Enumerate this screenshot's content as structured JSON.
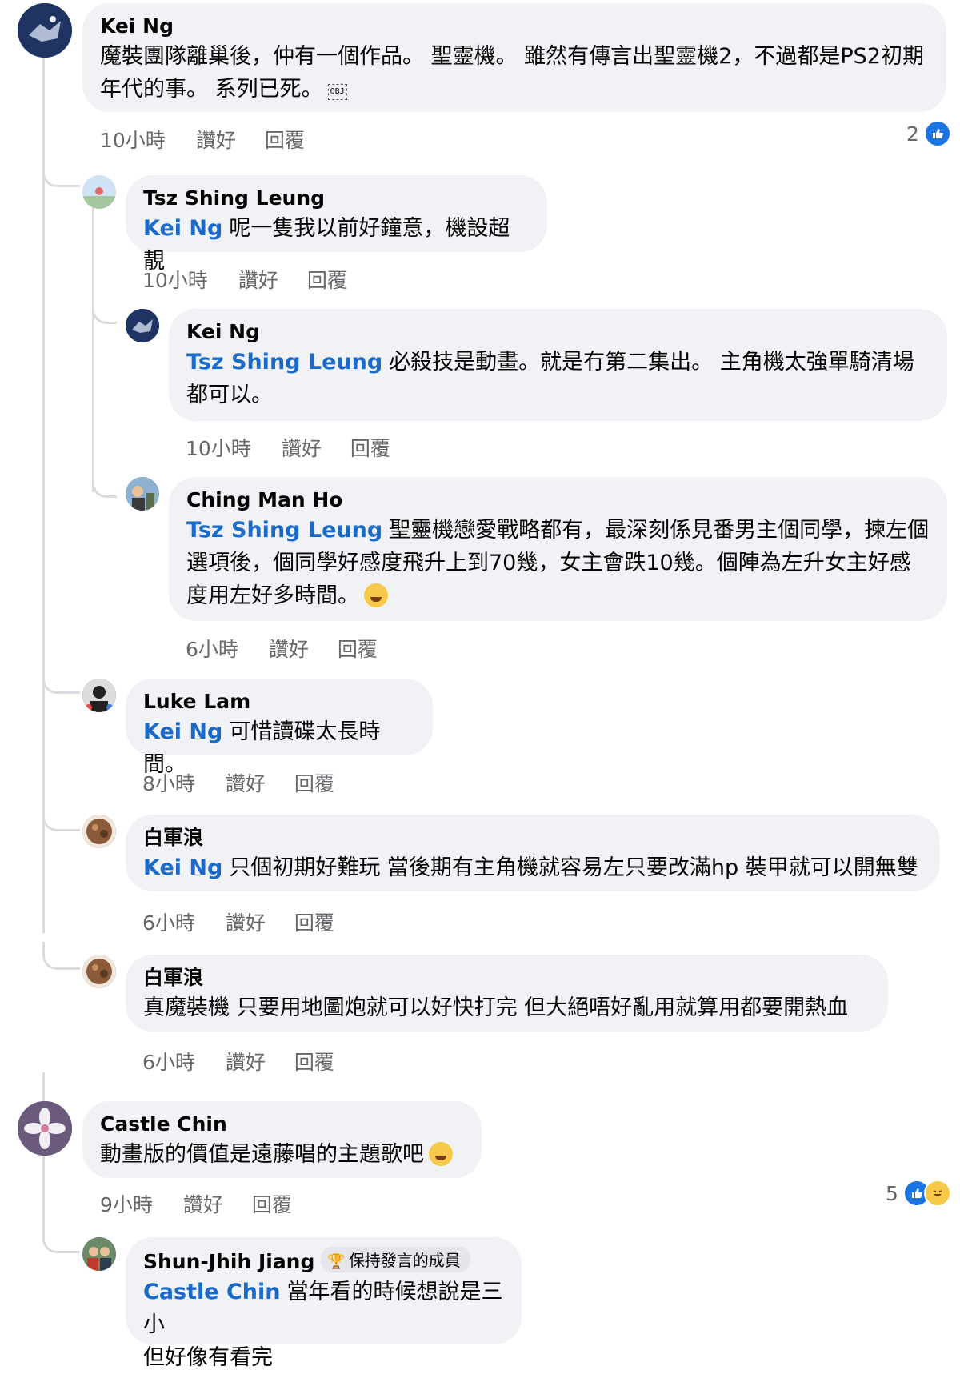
{
  "comments": [
    {
      "author": "Kei Ng",
      "mention": "",
      "text": "魔裝團隊離巢後，仲有一個作品。 聖靈機。 雖然有傳言出聖靈機2，不過都是PS2初期年代的事。 系列已死。",
      "obj": "OBJ",
      "time": "10小時",
      "like": "讚好",
      "reply": "回覆",
      "reactions": "2"
    },
    {
      "author": "Tsz Shing Leung",
      "mention": "Kei Ng",
      "text": "呢一隻我以前好鐘意，機設超靚",
      "time": "10小時",
      "like": "讚好",
      "reply": "回覆"
    },
    {
      "author": "Kei Ng",
      "mention": "Tsz Shing Leung",
      "text": "必殺技是動畫。就是冇第二集出。 主角機太強單騎清場都可以。",
      "time": "10小時",
      "like": "讚好",
      "reply": "回覆"
    },
    {
      "author": "Ching Man Ho",
      "mention": "Tsz Shing Leung",
      "text": "聖靈機戀愛戰略都有，最深刻係見番男主個同學，揀左個選項後，個同學好感度飛升上到70幾，女主會跌10幾。個陣為左升女主好感度用左好多時間。",
      "time": "6小時",
      "like": "讚好",
      "reply": "回覆"
    },
    {
      "author": "Luke Lam",
      "mention": "Kei Ng",
      "text": "可惜讀碟太長時間。",
      "time": "8小時",
      "like": "讚好",
      "reply": "回覆"
    },
    {
      "author": "白軍浪",
      "mention": "Kei Ng",
      "text": "只個初期好難玩 當後期有主角機就容易左只要改滿hp 裝甲就可以開無雙",
      "time": "6小時",
      "like": "讚好",
      "reply": "回覆"
    },
    {
      "author": "白軍浪",
      "mention": "",
      "text": "真魔裝機 只要用地圖炮就可以好快打完 但大絕唔好亂用就算用都要開熱血",
      "time": "6小時",
      "like": "讚好",
      "reply": "回覆"
    },
    {
      "author": "Castle Chin",
      "mention": "",
      "text": "動畫版的價值是遠藤唱的主題歌吧",
      "time": "9小時",
      "like": "讚好",
      "reply": "回覆",
      "reactions": "5"
    },
    {
      "author": "Shun-Jhih Jiang",
      "badge": "保持發言的成員",
      "mention": "Castle Chin",
      "text": "當年看的時候想說是三小",
      "text2": "但好像有看完"
    }
  ],
  "colors": {
    "mention": "#1a6ac9",
    "bubble": "#f0f2f5",
    "meta": "#65676b",
    "like": "#1b74e4"
  },
  "icons": {
    "like": "thumbs-up-icon",
    "haha": "laughing-emoji-icon",
    "badge": "trophy-icon"
  }
}
